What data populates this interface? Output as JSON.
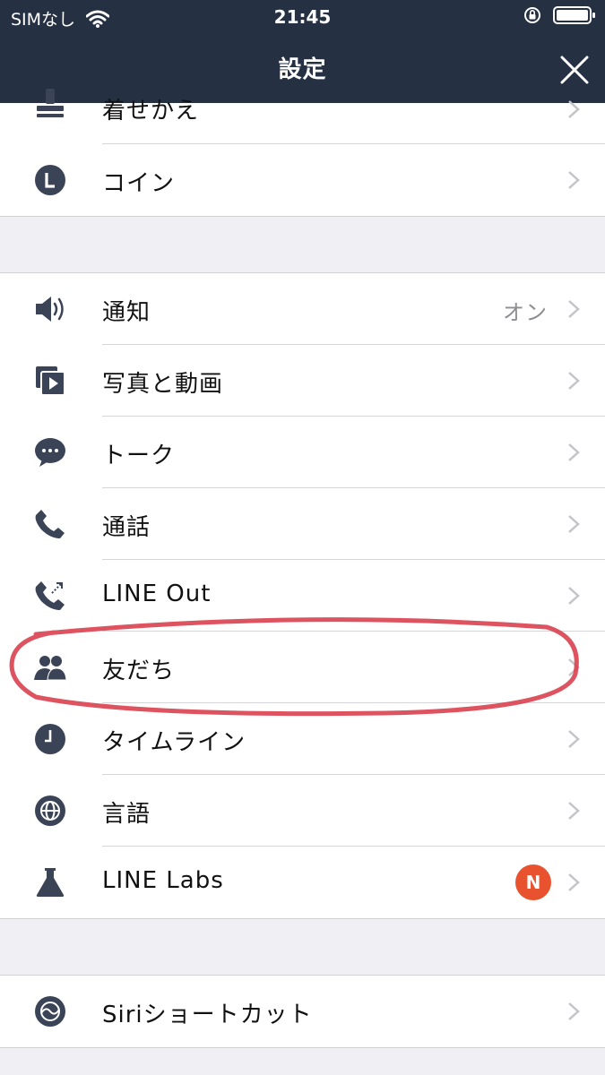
{
  "status_bar": {
    "carrier": "SIMなし",
    "time": "21:45"
  },
  "header": {
    "title": "設定"
  },
  "groups": [
    {
      "items": [
        {
          "key": "themes",
          "label": "着せかえ",
          "icon": "theme-icon"
        },
        {
          "key": "coins",
          "label": "コイン",
          "icon": "coin-icon"
        }
      ]
    },
    {
      "items": [
        {
          "key": "notifications",
          "label": "通知",
          "value": "オン",
          "icon": "speaker-icon"
        },
        {
          "key": "photos-videos",
          "label": "写真と動画",
          "icon": "photo-video-icon"
        },
        {
          "key": "chats",
          "label": "トーク",
          "icon": "chat-bubble-icon"
        },
        {
          "key": "calls",
          "label": "通話",
          "icon": "phone-icon"
        },
        {
          "key": "line-out",
          "label": "LINE Out",
          "icon": "phone-out-icon"
        },
        {
          "key": "friends",
          "label": "友だち",
          "icon": "friends-icon"
        },
        {
          "key": "timeline",
          "label": "タイムライン",
          "icon": "clock-icon"
        },
        {
          "key": "language",
          "label": "言語",
          "icon": "globe-icon"
        },
        {
          "key": "line-labs",
          "label": "LINE Labs",
          "badge": "N",
          "icon": "flask-icon"
        }
      ]
    },
    {
      "items": [
        {
          "key": "siri-shortcuts",
          "label": "Siriショートカット",
          "icon": "siri-icon"
        }
      ]
    }
  ],
  "colors": {
    "header_bg": "#263043",
    "icon": "#3b4356",
    "badge": "#e8522e",
    "highlight": "#d9404f"
  }
}
